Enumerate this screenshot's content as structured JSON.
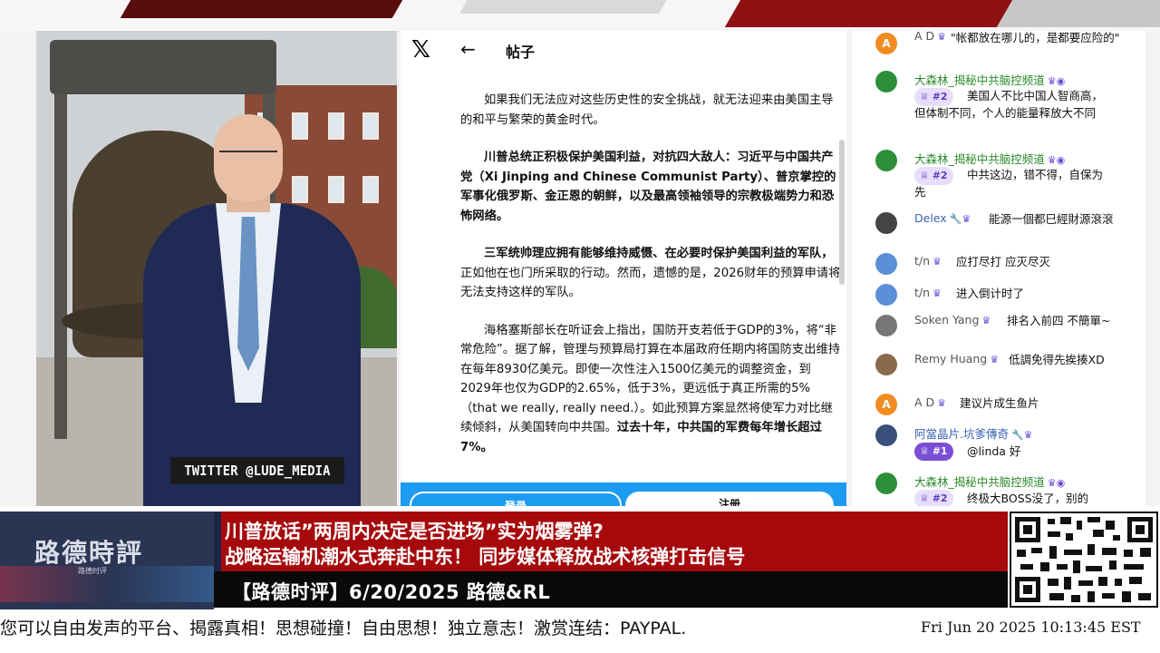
{
  "camera": {
    "twitter_tag": "TWITTER @LUDE_MEDIA"
  },
  "post": {
    "x_logo": "𝕏",
    "back_icon": "arrow-left-icon",
    "back_glyph": "←",
    "title": "帖子",
    "p1": "如果我们无法应对这些历史性的安全挑战，就无法迎来由美国主导的和平与繁荣的黄金时代。",
    "p2": "川普总统正积极保护美国利益，对抗四大敌人：习近平与中国共产党（Xi Jinping and Chinese Communist Party）、普京掌控的军事化俄罗斯、金正恩的朝鲜，以及最高领袖领导的宗教极端势力和恐怖网络。",
    "p3_bold": "三军统帅理应拥有能够维持威慑、在必要时保护美国利益的军队，",
    "p3_rest": "正如他在也门所采取的行动。然而，遗憾的是，2026财年的预算申请将无法支持这样的军队。",
    "p4_rest": "海格塞斯部长在听证会上指出，国防开支若低于GDP的3%，将“非常危险”。据了解，管理与预算局打算在本届政府任期内将国防支出维持在每年8930亿美元。即使一次性注入1500亿美元的调整资金，到2029年也仅为GDP的2.65%，低于3%，更远低于真正所需的5%（that we really, really need.）。如此预算方案显然将使军力对比继续倾斜，从美国转向中共国。",
    "p4_bold": "过去十年，中共国的军费每年增长超过7%。",
    "ellipsis": "......",
    "login": "登录",
    "signup": "注册"
  },
  "chat": {
    "messages": [
      {
        "avatar": "A",
        "avatar_color": "#f08c22",
        "name": "A D",
        "text": "\"帐都放在哪儿的，是都要应险的\""
      },
      {
        "avatar": "",
        "avatar_color": "#2d8f3a",
        "name": "大森林_揭秘中共脑控频道",
        "chip": "#2",
        "text": "美国人不比中国人智商高，但体制不同，个人的能量释放大不同"
      },
      {
        "avatar": "",
        "avatar_color": "#2d8f3a",
        "name": "大森林_揭秘中共脑控频道",
        "chip": "#2",
        "text": "中共这边，错不得，自保为先"
      },
      {
        "avatar": "",
        "avatar_color": "#444",
        "name": "Delex",
        "text": "能源一個都巳經財源滾滾"
      },
      {
        "avatar": "",
        "avatar_color": "#5b8fd6",
        "name": "t/n",
        "text": "应打尽打 应灭尽灭"
      },
      {
        "avatar": "",
        "avatar_color": "#5b8fd6",
        "name": "t/n",
        "text": "进入倒计时了"
      },
      {
        "avatar": "",
        "avatar_color": "#777",
        "name": "Soken Yang",
        "text": "排名入前四 不簡單~"
      },
      {
        "avatar": "",
        "avatar_color": "#8a6a4a",
        "name": "Remy Huang",
        "text": "低調免得先挨揍XD"
      },
      {
        "avatar": "A",
        "avatar_color": "#f08c22",
        "name": "A D",
        "text": "建议片成生鱼片"
      },
      {
        "avatar": "",
        "avatar_color": "#3a4f7a",
        "name": "阿當晶片.坑爹傳奇",
        "chip": "#1",
        "text": "@linda 好"
      },
      {
        "avatar": "",
        "avatar_color": "#2d8f3a",
        "name": "大森林_揭秘中共脑控频道",
        "chip": "#2",
        "text": "终极大BOSS没了，别的"
      }
    ]
  },
  "bottom": {
    "logo_text": "路德時評",
    "logo_sub": "路德时评",
    "headline_1": "川普放话”两周内决定是否进场”实为烟雾弹?",
    "headline_2": "战略运输机潮水式奔赴中东！ 同步媒体释放战术核弹打击信号",
    "subtitle": "【路德时评】6/20/2025 路德&RL",
    "ticker": "您可以自由发声的平台、揭露真相！思想碰撞！自由思想！独立意志！激赏连结：PAYPAL.",
    "clock": "Fri Jun 20 2025 10:13:45 EST"
  },
  "colors": {
    "headline_bg": "#a6090c",
    "twitter_blue": "#1d9bf0",
    "chat_name": "#2a8a2a",
    "chip_purple": "#e6defa"
  }
}
